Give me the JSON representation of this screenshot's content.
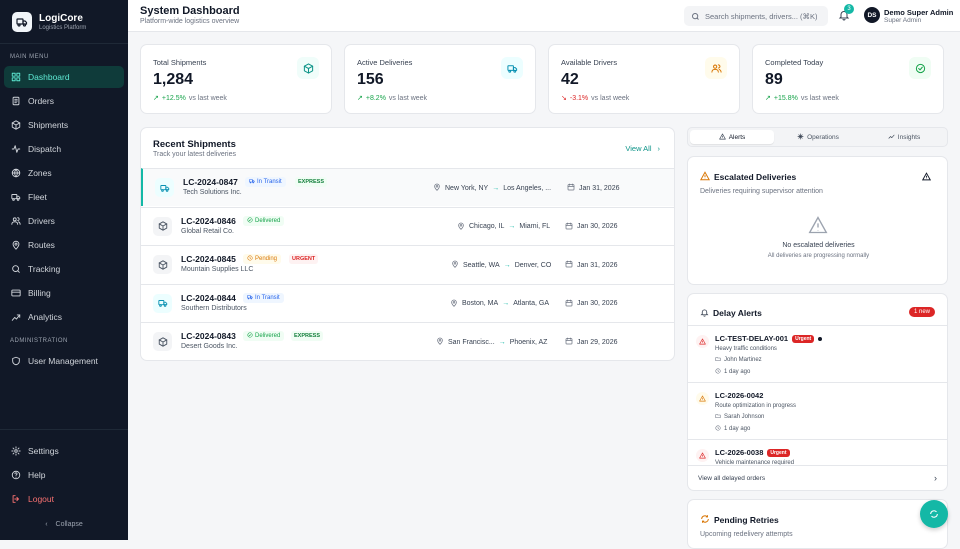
{
  "brand": {
    "name": "LogiCore",
    "subtitle": "Logistics Platform"
  },
  "sidebar": {
    "main_label": "MAIN MENU",
    "main_items": [
      {
        "label": "Dashboard",
        "icon": "dashboard-icon",
        "active": true
      },
      {
        "label": "Orders",
        "icon": "orders-icon"
      },
      {
        "label": "Shipments",
        "icon": "box-icon"
      },
      {
        "label": "Dispatch",
        "icon": "dispatch-icon"
      },
      {
        "label": "Zones",
        "icon": "globe-icon"
      },
      {
        "label": "Fleet",
        "icon": "truck-icon"
      },
      {
        "label": "Drivers",
        "icon": "users-icon"
      },
      {
        "label": "Routes",
        "icon": "map-pin-icon"
      },
      {
        "label": "Tracking",
        "icon": "search-icon"
      },
      {
        "label": "Billing",
        "icon": "credit-card-icon"
      },
      {
        "label": "Analytics",
        "icon": "chart-icon"
      }
    ],
    "admin_label": "ADMINISTRATION",
    "admin_items": [
      {
        "label": "User Management",
        "icon": "shield-icon"
      }
    ],
    "bottom_items": [
      {
        "label": "Settings",
        "icon": "gear-icon"
      },
      {
        "label": "Help",
        "icon": "help-icon"
      },
      {
        "label": "Logout",
        "icon": "logout-icon"
      }
    ],
    "collapse_label": "Collapse"
  },
  "header": {
    "title": "System Dashboard",
    "subtitle": "Platform-wide logistics overview",
    "search_placeholder": "Search shipments, drivers... (⌘K)",
    "notification_count": "3",
    "user_initials": "DS",
    "user_name": "Demo Super Admin",
    "user_role": "Super Admin"
  },
  "stats": [
    {
      "label": "Total Shipments",
      "value": "1,284",
      "trend": "+12.5%",
      "trend_dir": "up",
      "trend_suffix": "vs last week",
      "icon": "box-icon",
      "color": "#0d9488",
      "bg": "#f0fdfa"
    },
    {
      "label": "Active Deliveries",
      "value": "156",
      "trend": "+8.2%",
      "trend_dir": "up",
      "trend_suffix": "vs last week",
      "icon": "truck-icon",
      "color": "#0891b2",
      "bg": "#ecfeff"
    },
    {
      "label": "Available Drivers",
      "value": "42",
      "trend": "-3.1%",
      "trend_dir": "down",
      "trend_suffix": "vs last week",
      "icon": "users-icon",
      "color": "#d97706",
      "bg": "#fffbeb"
    },
    {
      "label": "Completed Today",
      "value": "89",
      "trend": "+15.8%",
      "trend_dir": "up",
      "trend_suffix": "vs last week",
      "icon": "check-circle-icon",
      "color": "#16a34a",
      "bg": "#f0fdf4"
    }
  ],
  "recent": {
    "title": "Recent Shipments",
    "subtitle": "Track your latest deliveries",
    "view_all": "View All",
    "rows": [
      {
        "id": "LC-2024-0847",
        "company": "Tech Solutions Inc.",
        "status": "In Transit",
        "priority": "EXPRESS",
        "from": "New York, NY",
        "to": "Los Angeles, ...",
        "date": "Jan 31, 2026"
      },
      {
        "id": "LC-2024-0846",
        "company": "Global Retail Co.",
        "status": "Delivered",
        "priority": "",
        "from": "Chicago, IL",
        "to": "Miami, FL",
        "date": "Jan 30, 2026"
      },
      {
        "id": "LC-2024-0845",
        "company": "Mountain Supplies LLC",
        "status": "Pending",
        "priority": "URGENT",
        "from": "Seattle, WA",
        "to": "Denver, CO",
        "date": "Jan 31, 2026"
      },
      {
        "id": "LC-2024-0844",
        "company": "Southern Distributors",
        "status": "In Transit",
        "priority": "",
        "from": "Boston, MA",
        "to": "Atlanta, GA",
        "date": "Jan 30, 2026"
      },
      {
        "id": "LC-2024-0843",
        "company": "Desert Goods Inc.",
        "status": "Delivered",
        "priority": "EXPRESS",
        "from": "San Francisc...",
        "to": "Phoenix, AZ",
        "date": "Jan 29, 2026"
      }
    ]
  },
  "right_tabs": [
    {
      "label": "Alerts",
      "icon": "alert-icon"
    },
    {
      "label": "Operations",
      "icon": "operations-icon"
    },
    {
      "label": "Insights",
      "icon": "trend-icon"
    }
  ],
  "escalated": {
    "title": "Escalated Deliveries",
    "subtitle": "Deliveries requiring supervisor attention",
    "empty_title": "No escalated deliveries",
    "empty_sub": "All deliveries are progressing normally"
  },
  "delay": {
    "title": "Delay Alerts",
    "badge": "1 new",
    "items": [
      {
        "id": "LC-TEST-DELAY-001",
        "tag": "Urgent",
        "desc": "Heavy traffic conditions",
        "person": "John Martinez",
        "time": "1 day ago",
        "level": "red"
      },
      {
        "id": "LC-2026-0042",
        "tag": "",
        "desc": "Route optimization in progress",
        "person": "Sarah Johnson",
        "time": "1 day ago",
        "level": "amber"
      },
      {
        "id": "LC-2026-0038",
        "tag": "Urgent",
        "desc": "Vehicle maintenance required",
        "person": "",
        "time": "",
        "level": "red"
      }
    ],
    "footer": "View all delayed orders"
  },
  "retries": {
    "title": "Pending Retries",
    "subtitle": "Upcoming redelivery attempts"
  }
}
